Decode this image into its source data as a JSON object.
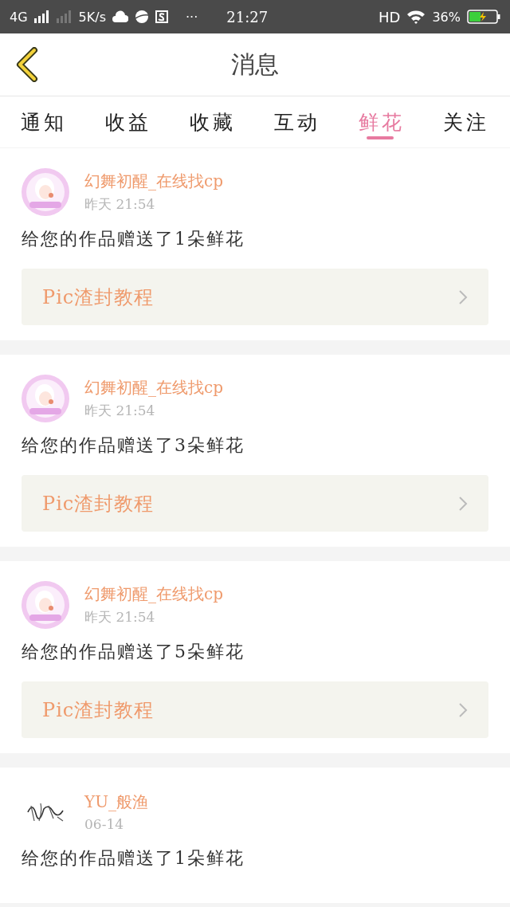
{
  "status_bar": {
    "network": "4G",
    "speed": "5K/s",
    "more": "···",
    "time": "21:27",
    "hd": "HD",
    "battery": "36%"
  },
  "header": {
    "title": "消息"
  },
  "tabs": [
    {
      "label": "通知",
      "selected": false
    },
    {
      "label": "收益",
      "selected": false
    },
    {
      "label": "收藏",
      "selected": false
    },
    {
      "label": "互动",
      "selected": false
    },
    {
      "label": "鲜花",
      "selected": true
    },
    {
      "label": "关注",
      "selected": false
    }
  ],
  "messages": [
    {
      "user": "幻舞初醒_在线找cp",
      "time": "昨天 21:54",
      "text": "给您的作品赠送了1朵鲜花",
      "work": "Pic渣封教程"
    },
    {
      "user": "幻舞初醒_在线找cp",
      "time": "昨天 21:54",
      "text": "给您的作品赠送了3朵鲜花",
      "work": "Pic渣封教程"
    },
    {
      "user": "幻舞初醒_在线找cp",
      "time": "昨天 21:54",
      "text": "给您的作品赠送了5朵鲜花",
      "work": "Pic渣封教程"
    },
    {
      "avatar": {
        "kind": "sketch"
      },
      "user": "YU_般渔",
      "time": "06-14",
      "text": "给您的作品赠送了1朵鲜花"
    }
  ]
}
